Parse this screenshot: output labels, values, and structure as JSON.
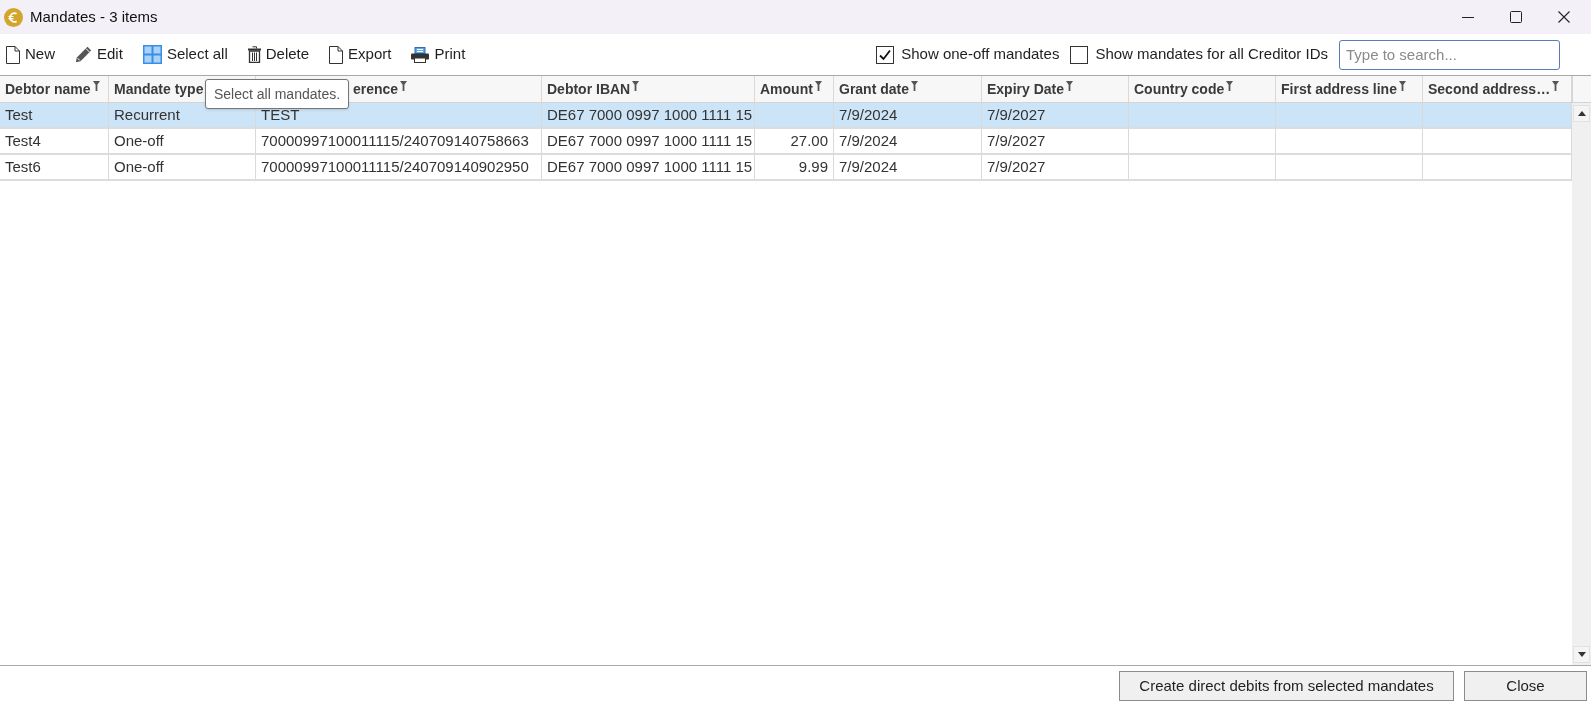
{
  "window": {
    "title": "Mandates - 3 items"
  },
  "toolbar": {
    "buttons": [
      {
        "kind": "new",
        "label": "New"
      },
      {
        "kind": "edit",
        "label": "Edit"
      },
      {
        "kind": "select_all",
        "label": "Select all"
      },
      {
        "kind": "delete",
        "label": "Delete"
      },
      {
        "kind": "export",
        "label": "Export"
      },
      {
        "kind": "print",
        "label": "Print"
      }
    ],
    "options": [
      {
        "label": "Show one-off mandates",
        "checked": true
      },
      {
        "label": "Show mandates for all Creditor IDs",
        "checked": false
      }
    ],
    "search": {
      "placeholder": "Type to search..."
    }
  },
  "tooltip": {
    "text": "Select all mandates."
  },
  "table": {
    "columns": [
      {
        "label": "Debtor name",
        "kind": "text",
        "filter_icon": true,
        "cut_start": false
      },
      {
        "label": "Mandate type",
        "kind": "text",
        "filter_icon": false,
        "cut_start": false
      },
      {
        "label": "erence",
        "kind": "text",
        "filter_icon": true,
        "cut_start": true
      },
      {
        "label": "Debtor IBAN",
        "kind": "text",
        "filter_icon": true,
        "cut_start": false
      },
      {
        "label": "Amount",
        "kind": "number",
        "filter_icon": true,
        "cut_start": false
      },
      {
        "label": "Grant date",
        "kind": "text",
        "filter_icon": true,
        "cut_start": false
      },
      {
        "label": "Expiry Date",
        "kind": "text",
        "filter_icon": true,
        "cut_start": false
      },
      {
        "label": "Country code",
        "kind": "text",
        "filter_icon": true,
        "cut_start": false
      },
      {
        "label": "First address line",
        "kind": "text",
        "filter_icon": true,
        "cut_start": false
      },
      {
        "label": "Second address…",
        "kind": "text",
        "filter_icon": true,
        "cut_start": false
      }
    ],
    "rows": [
      {
        "selected": true,
        "cells": [
          "Test",
          "Recurrent",
          "TEST",
          "DE67 7000 0997 1000 1111 15",
          null,
          "7/9/2024",
          "7/9/2027",
          null,
          null,
          null
        ]
      },
      {
        "selected": false,
        "cells": [
          "Test4",
          "One-off",
          "70000997100011115/240709140758663",
          "DE67 7000 0997 1000 1111 15",
          "27.00",
          "7/9/2024",
          "7/9/2027",
          null,
          null,
          null
        ]
      },
      {
        "selected": false,
        "cells": [
          "Test6",
          "One-off",
          "70000997100011115/240709140902950",
          "DE67 7000 0997 1000 1111 15",
          "9.99",
          "7/9/2024",
          "7/9/2027",
          null,
          null,
          null
        ]
      }
    ]
  },
  "footer": {
    "buttons": [
      {
        "label": "Create direct debits from selected mandates"
      },
      {
        "label": "Close"
      }
    ]
  }
}
